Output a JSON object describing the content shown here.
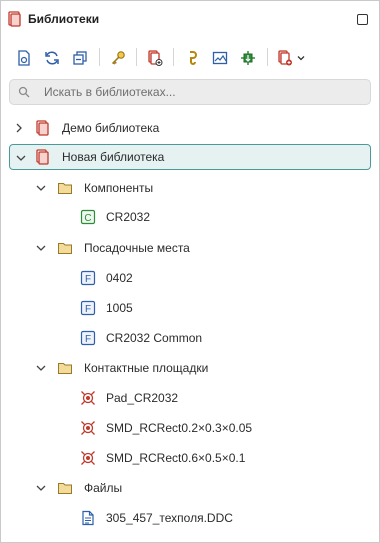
{
  "panel": {
    "title": "Библиотеки"
  },
  "toolbar": {
    "buttons": [
      "open-library-icon",
      "refresh-icon",
      "collapse-all-icon",
      "key-icon",
      "new-library-icon",
      "hook-icon",
      "image-icon",
      "component-symbol-icon",
      "add-component-icon",
      "dropdown-chevron-icon"
    ]
  },
  "search": {
    "placeholder": "Искать в библиотеках..."
  },
  "tree": {
    "demo_library": "Демо библиотека",
    "new_library": "Новая библиотека",
    "components_folder": "Компоненты",
    "component_cr2032": "CR2032",
    "footprints_folder": "Посадочные места",
    "footprint_0402": "0402",
    "footprint_1005": "1005",
    "footprint_cr2032_common": "CR2032 Common",
    "pads_folder": "Контактные площадки",
    "pad_cr2032": "Pad_CR2032",
    "pad_smd_1": "SMD_RCRect0.2×0.3×0.05",
    "pad_smd_2": "SMD_RCRect0.6×0.5×0.1",
    "files_folder": "Файлы",
    "file_ddc": "305_457_техполя.DDC"
  },
  "icon_letters": {
    "component": "C",
    "footprint": "F"
  },
  "colors": {
    "selected_border": "#4a9a9a",
    "selected_bg": "#e6f1f1",
    "library_red": "#c0392b",
    "toolbar_blue": "#2e5fa8",
    "folder_fill": "#f3dc9a",
    "component_green": "#2e8b3a"
  }
}
